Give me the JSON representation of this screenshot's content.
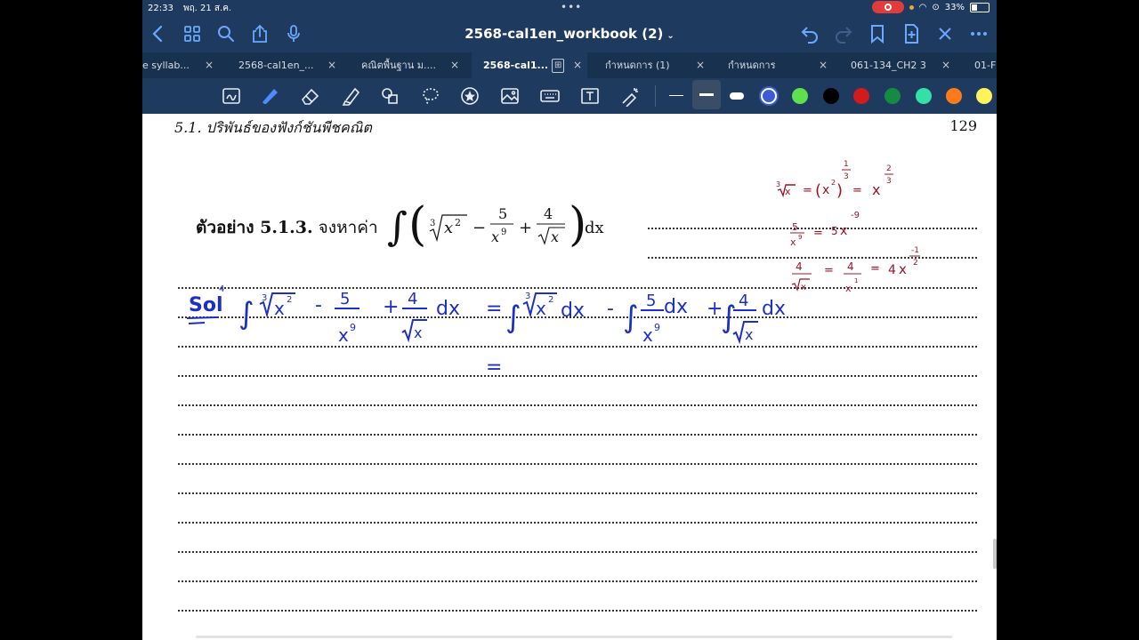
{
  "status_bar": {
    "time": "22:33",
    "date": "พฤ. 21 ส.ค.",
    "battery": "33%"
  },
  "header": {
    "title": "2568-cal1en_workbook (2)"
  },
  "tabs": [
    {
      "label": "e syllab...",
      "active": false
    },
    {
      "label": "2568-cal1en_...",
      "active": false
    },
    {
      "label": "คณิตพื้นฐาน ม....",
      "active": false
    },
    {
      "label": "2568-cal1...",
      "active": true
    },
    {
      "label": "กำหนดการ (1)",
      "active": false
    },
    {
      "label": "กำหนดการ",
      "active": false
    },
    {
      "label": "061-134_CH2 3",
      "active": false
    },
    {
      "label": "01-F",
      "active": false
    }
  ],
  "tab_close_glyph": "×",
  "icons": {
    "back": "chevron-left-icon",
    "grid": "grid-icon",
    "search": "search-icon",
    "share": "share-icon",
    "mic": "microphone-icon",
    "undo": "undo-icon",
    "redo": "redo-icon",
    "bookmark": "bookmark-icon",
    "add_page": "add-page-icon",
    "close": "close-icon",
    "more": "more-icon"
  },
  "palette": [
    "#3b5bdb",
    "#5ee04f",
    "#000000",
    "#d41a1a",
    "#148a42",
    "#35e0a6",
    "#ff7a1a",
    "#fff35c"
  ],
  "colors": {
    "ink_blue": "#1d2fc4",
    "ink_red": "#a01425",
    "bar": "#1f3a5f"
  },
  "page": {
    "section_header": "5.1.  ปริพันธ์ของฟังก์ชันพีชคณิต",
    "page_number": "129",
    "example_label": "ตัวอย่าง 5.1.3.",
    "example_text": "จงหาค่า",
    "integral_d": "dx"
  },
  "handwriting": {
    "sol": "Sol",
    "dx": "dx",
    "plus": "+",
    "minus": "-",
    "eq": "=",
    "n4": "4",
    "n5": "5",
    "n2": "2",
    "n3": "3",
    "n9": "9",
    "n1": "1",
    "x": "x",
    "neg9": "-9",
    "neg_half": "-1"
  }
}
